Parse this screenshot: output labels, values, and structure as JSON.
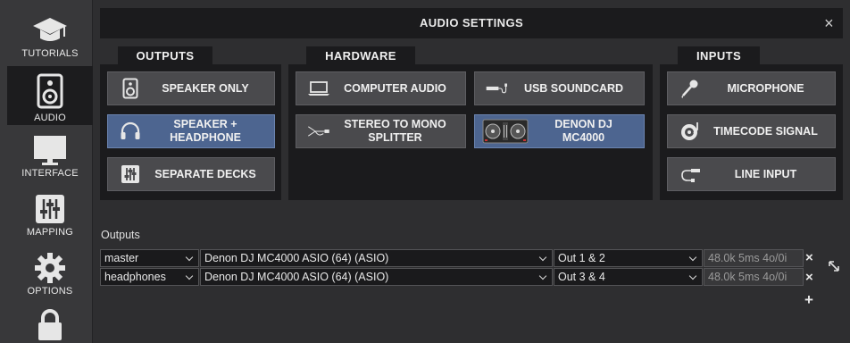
{
  "sidebar": {
    "items": [
      {
        "label": "TUTORIALS",
        "icon": "graduation-cap-icon"
      },
      {
        "label": "AUDIO",
        "icon": "speaker-icon",
        "active": true
      },
      {
        "label": "INTERFACE",
        "icon": "monitor-icon"
      },
      {
        "label": "MAPPING",
        "icon": "sliders-icon"
      },
      {
        "label": "OPTIONS",
        "icon": "gear-icon"
      },
      {
        "label": "",
        "icon": "lock-icon"
      }
    ]
  },
  "window": {
    "title": "AUDIO SETTINGS",
    "close_label": "×"
  },
  "sections": {
    "outputs": {
      "title": "OUTPUTS",
      "buttons": [
        {
          "label": "SPEAKER ONLY",
          "icon": "speaker-icon",
          "selected": false
        },
        {
          "label": "SPEAKER +\nHEADPHONE",
          "icon": "headphones-icon",
          "selected": true
        },
        {
          "label": "SEPARATE DECKS",
          "icon": "mixer-icon",
          "selected": false
        }
      ]
    },
    "hardware": {
      "title": "HARDWARE",
      "buttons": [
        {
          "label": "COMPUTER AUDIO",
          "icon": "laptop-icon",
          "selected": false
        },
        {
          "label": "USB SOUNDCARD",
          "icon": "usb-soundcard-icon",
          "selected": false
        },
        {
          "label": "STEREO TO MONO\nSPLITTER",
          "icon": "splitter-cable-icon",
          "selected": false
        },
        {
          "label": "DENON DJ\nMC4000",
          "icon": "dj-controller-icon",
          "selected": true
        }
      ]
    },
    "inputs": {
      "title": "INPUTS",
      "buttons": [
        {
          "label": "MICROPHONE",
          "icon": "microphone-icon",
          "selected": false
        },
        {
          "label": "TIMECODE SIGNAL",
          "icon": "turntable-icon",
          "selected": false
        },
        {
          "label": "LINE INPUT",
          "icon": "cable-jack-icon",
          "selected": false
        }
      ]
    }
  },
  "outputs_table": {
    "label": "Outputs",
    "rows": [
      {
        "channel": "master",
        "device": "Denon DJ MC4000 ASIO (64) (ASIO)",
        "ports": "Out 1 & 2",
        "info": "48.0k 5ms 4o/0i"
      },
      {
        "channel": "headphones",
        "device": "Denon DJ MC4000 ASIO (64) (ASIO)",
        "ports": "Out 3 & 4",
        "info": "48.0k 5ms 4o/0i"
      }
    ],
    "remove_label": "×",
    "add_label": "+",
    "swap_icon": "swap-arrows-icon"
  },
  "colors": {
    "accent_selected": "#4d6590",
    "button": "#4a4a4d",
    "panel": "#1b1b1d"
  }
}
